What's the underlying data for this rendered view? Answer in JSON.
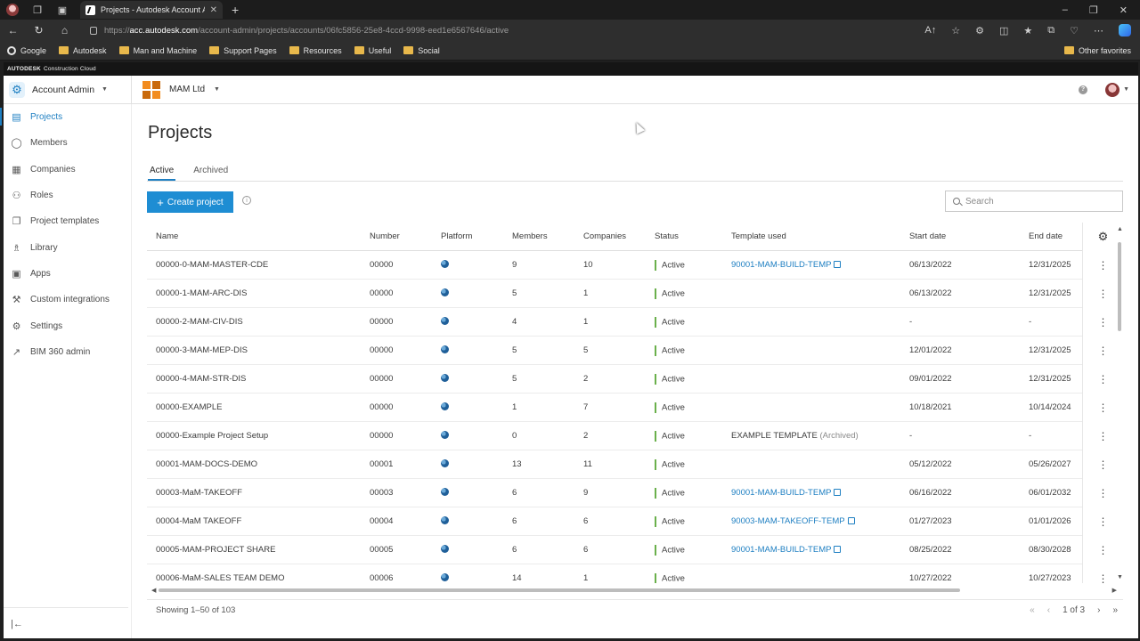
{
  "browser": {
    "tab_title": "Projects - Autodesk Account Adm",
    "url_prefix": "https://",
    "url_host": "acc.autodesk.com",
    "url_path": "/account-admin/projects/accounts/06fc5856-25e8-4ccd-9998-eed1e6567646/active",
    "favorites": [
      "Google",
      "Autodesk",
      "Man and Machine",
      "Support Pages",
      "Resources",
      "Useful",
      "Social"
    ],
    "other_favorites": "Other favorites"
  },
  "banner": {
    "brand": "AUTODESK",
    "product": "Construction Cloud"
  },
  "topbar": {
    "module": "Account Admin",
    "org": "MAM Ltd"
  },
  "sidebar": {
    "items": [
      {
        "label": "Projects",
        "icon": "projects-icon",
        "active": true
      },
      {
        "label": "Members",
        "icon": "members-icon"
      },
      {
        "label": "Companies",
        "icon": "companies-icon"
      },
      {
        "label": "Roles",
        "icon": "roles-icon"
      },
      {
        "label": "Project templates",
        "icon": "project-templates-icon"
      },
      {
        "label": "Library",
        "icon": "library-icon"
      },
      {
        "label": "Apps",
        "icon": "apps-icon"
      },
      {
        "label": "Custom integrations",
        "icon": "custom-integrations-icon"
      },
      {
        "label": "Settings",
        "icon": "settings-icon"
      },
      {
        "label": "BIM 360 admin",
        "icon": "external-link-icon"
      }
    ]
  },
  "main": {
    "title": "Projects",
    "tabs": [
      "Active",
      "Archived"
    ],
    "create_label": "Create project",
    "search_placeholder": "Search"
  },
  "table": {
    "columns": [
      "Name",
      "Number",
      "Platform",
      "Members",
      "Companies",
      "Status",
      "Template used",
      "Start date",
      "End date"
    ],
    "rows": [
      {
        "name": "00000-0-MAM-MASTER-CDE",
        "number": "00000",
        "members": "9",
        "companies": "10",
        "status": "Active",
        "template": "90001-MAM-BUILD-TEMP",
        "template_link": true,
        "start": "06/13/2022",
        "end": "12/31/2025"
      },
      {
        "name": "00000-1-MAM-ARC-DIS",
        "number": "00000",
        "members": "5",
        "companies": "1",
        "status": "Active",
        "template": "",
        "start": "06/13/2022",
        "end": "12/31/2025"
      },
      {
        "name": "00000-2-MAM-CIV-DIS",
        "number": "00000",
        "members": "4",
        "companies": "1",
        "status": "Active",
        "template": "",
        "start": "-",
        "end": "-"
      },
      {
        "name": "00000-3-MAM-MEP-DIS",
        "number": "00000",
        "members": "5",
        "companies": "5",
        "status": "Active",
        "template": "",
        "start": "12/01/2022",
        "end": "12/31/2025"
      },
      {
        "name": "00000-4-MAM-STR-DIS",
        "number": "00000",
        "members": "5",
        "companies": "2",
        "status": "Active",
        "template": "",
        "start": "09/01/2022",
        "end": "12/31/2025"
      },
      {
        "name": "00000-EXAMPLE",
        "number": "00000",
        "members": "1",
        "companies": "7",
        "status": "Active",
        "template": "",
        "start": "10/18/2021",
        "end": "10/14/2024"
      },
      {
        "name": "00000-Example Project Setup",
        "number": "00000",
        "members": "0",
        "companies": "2",
        "status": "Active",
        "template": "EXAMPLE TEMPLATE",
        "template_suffix": "(Archived)",
        "start": "-",
        "end": "-"
      },
      {
        "name": "00001-MAM-DOCS-DEMO",
        "number": "00001",
        "members": "13",
        "companies": "11",
        "status": "Active",
        "template": "",
        "start": "05/12/2022",
        "end": "05/26/2027"
      },
      {
        "name": "00003-MaM-TAKEOFF",
        "number": "00003",
        "members": "6",
        "companies": "9",
        "status": "Active",
        "template": "90001-MAM-BUILD-TEMP",
        "template_link": true,
        "start": "06/16/2022",
        "end": "06/01/2032"
      },
      {
        "name": "00004-MaM TAKEOFF",
        "number": "00004",
        "members": "6",
        "companies": "6",
        "status": "Active",
        "template": "90003-MAM-TAKEOFF-TEMP",
        "template_link": true,
        "start": "01/27/2023",
        "end": "01/01/2026"
      },
      {
        "name": "00005-MAM-PROJECT SHARE",
        "number": "00005",
        "members": "6",
        "companies": "6",
        "status": "Active",
        "template": "90001-MAM-BUILD-TEMP",
        "template_link": true,
        "start": "08/25/2022",
        "end": "08/30/2028"
      },
      {
        "name": "00006-MaM-SALES TEAM DEMO",
        "number": "00006",
        "members": "14",
        "companies": "1",
        "status": "Active",
        "template": "",
        "start": "10/27/2022",
        "end": "10/27/2023"
      }
    ]
  },
  "footer": {
    "showing": "Showing 1–50 of 103",
    "page": "1 of 3"
  },
  "colors": {
    "accent": "#1e7fc2",
    "status_active": "#6ab04c",
    "button": "#1e8dd3"
  }
}
